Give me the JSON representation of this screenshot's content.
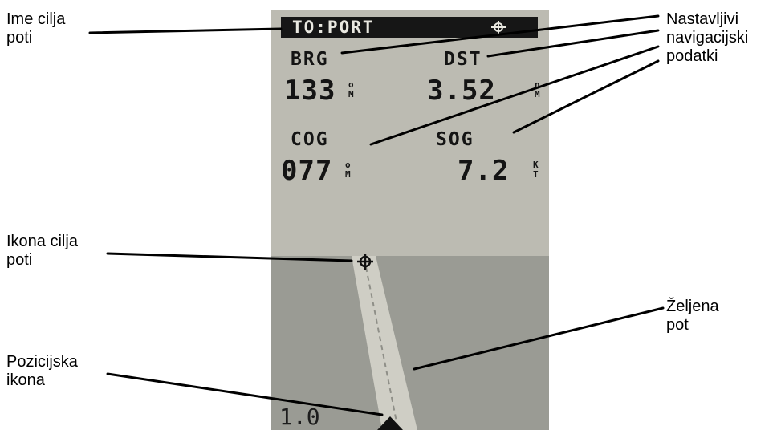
{
  "device": {
    "header": "TO:PORT",
    "header_icon": "crosshair-waypoint-icon",
    "fields": [
      {
        "label": "BRG",
        "value": "133",
        "unit_top": "o",
        "unit_bottom": "M"
      },
      {
        "label": "DST",
        "value": "3.52",
        "unit_top": "n",
        "unit_bottom": "M"
      },
      {
        "label": "COG",
        "value": "077",
        "unit_top": "o",
        "unit_bottom": "M"
      },
      {
        "label": "SOG",
        "value": "7.2",
        "unit_top": "K",
        "unit_bottom": "T"
      }
    ],
    "scale": "1.0",
    "waypoint_icon": "crosshair-waypoint-icon",
    "position_icon": "boat-arrow-icon"
  },
  "annotations": {
    "waypoint_name": "Ime cilja\npoti",
    "nav_data": "Nastavljivi\nnavigacijski\npodatki",
    "waypoint_icon": "Ikona cilja\npoti",
    "desired_course": "Željena\npot",
    "position_icon": "Pozicijska\nikona"
  },
  "colors": {
    "screen_bg": "#bcbbb2",
    "water": "#9a9b94",
    "course_band": "#cfcec5",
    "text": "#141414",
    "header_bg": "#161616",
    "header_text": "#e9e8e0"
  }
}
